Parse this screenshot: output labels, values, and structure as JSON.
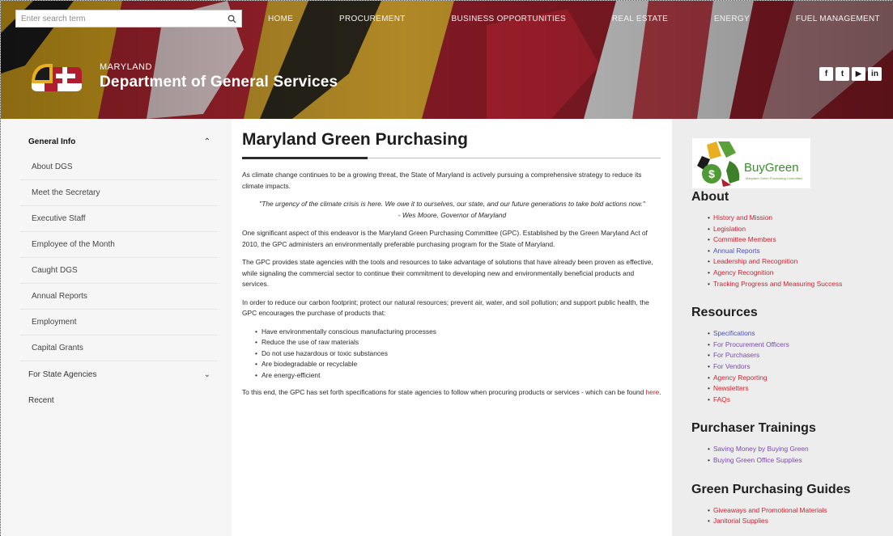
{
  "search": {
    "placeholder": "Enter search term",
    "icon": "search-icon"
  },
  "topnav": [
    "HOME",
    "PROCUREMENT",
    "BUSINESS OPPORTUNITIES",
    "REAL ESTATE",
    "ENERGY",
    "FUEL MANAGEMENT"
  ],
  "brand": {
    "subtitle": "MARYLAND",
    "title": "Department of General Services"
  },
  "social": [
    {
      "icon": "facebook-icon",
      "glyph": "f"
    },
    {
      "icon": "twitter-icon",
      "glyph": "t"
    },
    {
      "icon": "youtube-icon",
      "glyph": "▶"
    },
    {
      "icon": "linkedin-icon",
      "glyph": "in"
    }
  ],
  "sidebar": {
    "general_info": "General Info",
    "general_items": [
      "About DGS",
      "Meet the Secretary",
      "Executive Staff",
      "Employee of the Month",
      "Caught DGS",
      "Annual Reports",
      "Employment",
      "Capital Grants"
    ],
    "for_state_agencies": "For State Agencies",
    "recent": "Recent"
  },
  "main": {
    "title": "Maryland Green Purchasing",
    "intro": "As climate change continues to be a growing threat, the State of Maryland is actively pursuing a comprehensive strategy to reduce its climate impacts.",
    "quote": "\"The urgency of the climate crisis is here.  We owe it to ourselves, our state, and our future generations to take bold actions now.\"",
    "quote_author": "- Wes Moore, Governor of Maryland",
    "para2": "One significant aspect of this endeavor is the Maryland Green Purchasing Committee (GPC). Established by the Green Maryland Act of 2010, the GPC administers an environmentally preferable purchasing program for the State of Maryland.",
    "para3": "The GPC provides state agencies with the tools and resources to take advantage of solutions that have already been proven as effective, while signaling the commercial sector to continue their commitment to developing new and environmentally beneficial products and services.",
    "para4": "In order to reduce our carbon footprint; protect our natural resources; prevent air, water, and soil pollution; and support public health, the GPC encourages the purchase of products that:",
    "bullets": [
      "Have environmentally conscious manufacturing processes",
      "Reduce the use of raw materials",
      "Do not use hazardous or toxic substances",
      "Are biodegradable or recyclable",
      "Are energy-efficient"
    ],
    "closing": "To this end, the GPC has set forth specifications for state agencies to follow when procuring products or services - which can be found ",
    "closing_link": "here",
    "closing_end": "."
  },
  "right": {
    "logo_text": "BuyGreen",
    "logo_tagline": "Maryland Green Purchasing Committee",
    "about_heading": "About",
    "about_links": [
      "History and Mission",
      "Legislation",
      "Committee Members",
      "Annual Reports",
      "Leadership and Recognition",
      "Agency Recognition",
      "Tracking Progress and Measuring Success"
    ],
    "resources_heading": "Resources",
    "resources_links": [
      "Specifications",
      "For Procurement Officers",
      "For Purchasers",
      "For Vendors",
      "Agency Reporting",
      "Newsletters",
      "FAQs"
    ],
    "trainings_heading": "Purchaser Trainings",
    "trainings_links": [
      "Saving Money by Buying Green",
      "Buying Green Office Supplies"
    ],
    "guides_heading": "Green Purchasing Guides",
    "guides_links": [
      "Giveaways and Promotional Materials",
      "Janitorial Supplies"
    ]
  },
  "colors": {
    "accent_red": "#cf2230",
    "link_blue": "#4a4fb8",
    "link_purple": "#7a4ab0",
    "flag_gold": "#e8b020",
    "flag_red": "#b01e2e"
  }
}
